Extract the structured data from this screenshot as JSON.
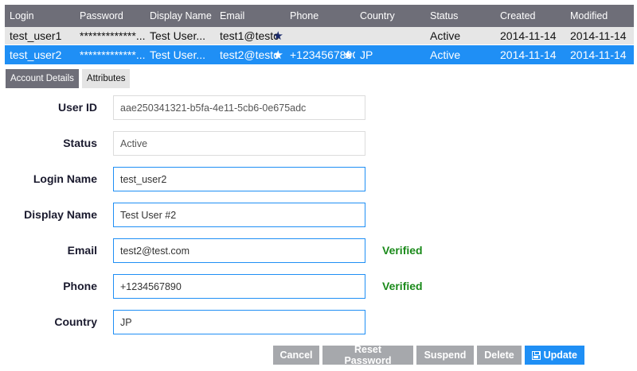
{
  "users_table": {
    "columns": [
      "Login",
      "Password",
      "Display Name",
      "Email",
      "Phone",
      "Country",
      "Status",
      "Created",
      "Modified"
    ],
    "rows": [
      {
        "login": "test_user1",
        "password": "*************...",
        "display_name": "Test User...",
        "email": "test1@testc",
        "phone": "",
        "country": "",
        "status": "Active",
        "created": "2014-11-14",
        "modified": "2014-11-14",
        "selected": false
      },
      {
        "login": "test_user2",
        "password": "*************...",
        "display_name": "Test User...",
        "email": "test2@testc",
        "phone": "+123456789C",
        "country": "JP",
        "status": "Active",
        "created": "2014-11-14",
        "modified": "2014-11-14",
        "selected": true
      }
    ],
    "star_icon": "★"
  },
  "tabs": [
    {
      "label": "Account Details",
      "active": true
    },
    {
      "label": "Attributes",
      "active": false
    }
  ],
  "form": {
    "user_id": {
      "label": "User ID",
      "value": "aae250341321-b5fa-4e11-5cb6-0e675adc"
    },
    "status": {
      "label": "Status",
      "value": "Active"
    },
    "login_name": {
      "label": "Login Name",
      "value": "test_user2"
    },
    "display_name": {
      "label": "Display Name",
      "value": "Test User #2"
    },
    "email": {
      "label": "Email",
      "value": "test2@test.com",
      "badge": "Verified"
    },
    "phone": {
      "label": "Phone",
      "value": "+1234567890",
      "badge": "Verified"
    },
    "country": {
      "label": "Country",
      "value": "JP"
    }
  },
  "actions": {
    "cancel": "Cancel",
    "reset_password": "Reset Password",
    "suspend": "Suspend",
    "delete": "Delete",
    "update": "Update"
  },
  "colors": {
    "header_bg": "#6e6e78",
    "selected_row": "#1f8ff5",
    "verified": "#1a8a1a",
    "button_gray": "#a6a8ac",
    "button_primary": "#1f8ff5"
  }
}
